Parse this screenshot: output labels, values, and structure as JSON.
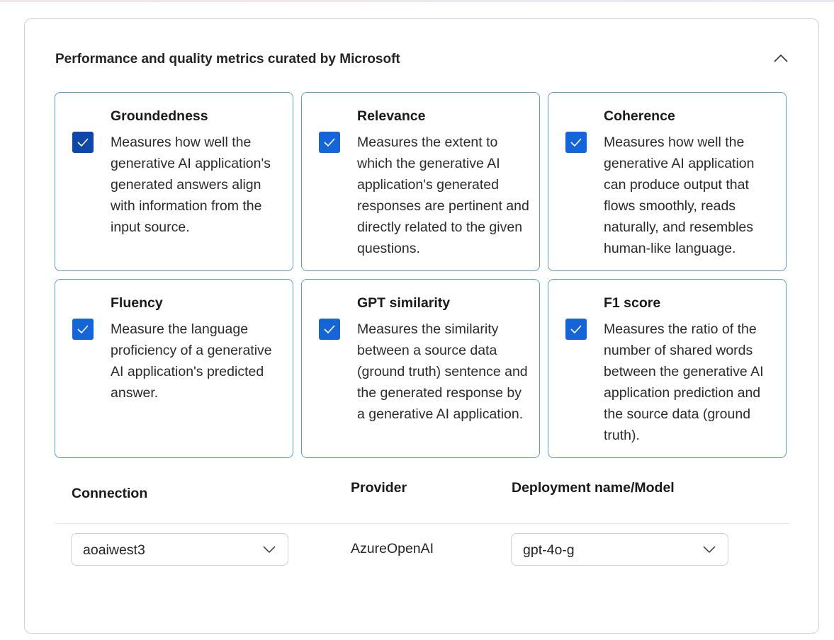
{
  "section": {
    "title": "Performance and quality metrics curated by Microsoft",
    "collapse_icon": "chevron-up-icon"
  },
  "metrics": [
    {
      "name": "Groundedness",
      "description": "Measures how well the generative AI application's generated answers align with information from the input source.",
      "checked": true
    },
    {
      "name": "Relevance",
      "description": "Measures the extent to which the generative AI application's generated responses are pertinent and directly related to the given questions.",
      "checked": true
    },
    {
      "name": "Coherence",
      "description": "Measures how well the generative AI application can produce output that flows smoothly, reads naturally, and resembles human-like language.",
      "checked": true
    },
    {
      "name": "Fluency",
      "description": "Measure the language proficiency of a generative AI application's predicted answer.",
      "checked": true
    },
    {
      "name": "GPT similarity",
      "description": "Measures the similarity between a source data (ground truth) sentence and the generated response by a generative AI application.",
      "checked": true
    },
    {
      "name": "F1 score",
      "description": "Measures the ratio of the number of shared words between the generative AI application prediction and the source data (ground truth).",
      "checked": true
    }
  ],
  "config": {
    "headers": {
      "connection": "Connection",
      "provider": "Provider",
      "deployment": "Deployment name/Model"
    },
    "connection_value": "aoaiwest3",
    "provider_value": "AzureOpenAI",
    "deployment_value": "gpt-4o-g"
  },
  "colors": {
    "accent": "#1565d8",
    "card_border": "#5b9bdc"
  }
}
